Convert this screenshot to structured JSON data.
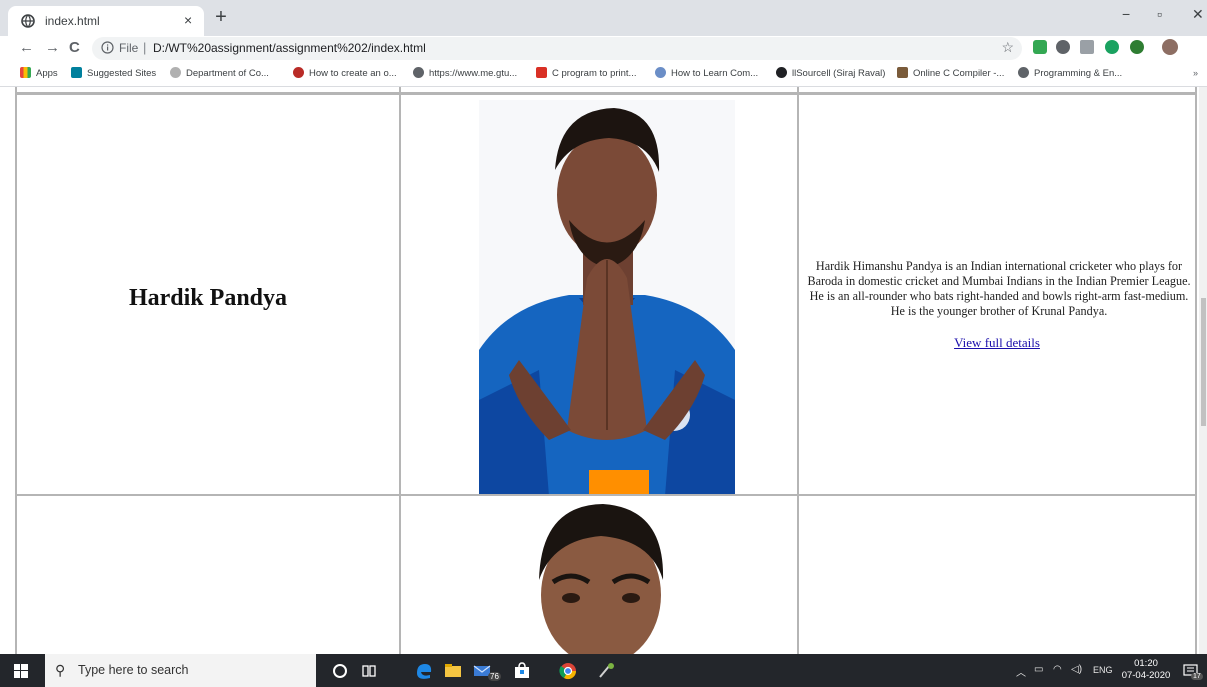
{
  "browser": {
    "tab_title": "index.html",
    "tab_close": "×",
    "new_tab": "+",
    "minimize": "−",
    "maximize": "▫",
    "close": "✕",
    "back": "←",
    "forward": "→",
    "reload": "C",
    "url_scheme": "File",
    "url_separator": "|",
    "url": "D:/WT%20assignment/assignment%202/index.html",
    "bookmark_star": "☆",
    "menu": "⋮"
  },
  "bookmarks": [
    {
      "label": "Apps",
      "color": "#e8453c"
    },
    {
      "label": "Suggested Sites",
      "color": "#1a73e8"
    },
    {
      "label": "Department of Co...",
      "color": "#b0b0b0"
    },
    {
      "label": "How to create an o...",
      "color": "#d93025"
    },
    {
      "label": "https://www.me.gtu...",
      "color": "#5f6368"
    },
    {
      "label": "C program to print...",
      "color": "#d93025"
    },
    {
      "label": "How to Learn Com...",
      "color": "#6b8ec7"
    },
    {
      "label": "llSourcell (Siraj Raval)",
      "color": "#202124"
    },
    {
      "label": "Online C Compiler -...",
      "color": "#7a5b3a"
    },
    {
      "label": "Programming & En...",
      "color": "#5f6368"
    }
  ],
  "bookmarks_more": "»",
  "page": {
    "player1": {
      "name": "Hardik Pandya",
      "description": "Hardik Himanshu Pandya is an Indian international cricketer who plays for Baroda in domestic cricket and Mumbai Indians in the Indian Premier League. He is an all-rounder who bats right-handed and bowls right-arm fast-medium. He is the younger brother of Krunal Pandya.",
      "link": "View full details"
    },
    "player2": {
      "name": "",
      "description": "",
      "link": ""
    }
  },
  "taskbar": {
    "search_placeholder": "Type here to search",
    "mail_badge": "76",
    "language": "ENG",
    "time": "01:20",
    "date": "07-04-2020",
    "notification_count": "17"
  },
  "colors": {
    "jersey": "#1565c0",
    "link": "#1a0dab",
    "taskbar": "#23262b"
  }
}
